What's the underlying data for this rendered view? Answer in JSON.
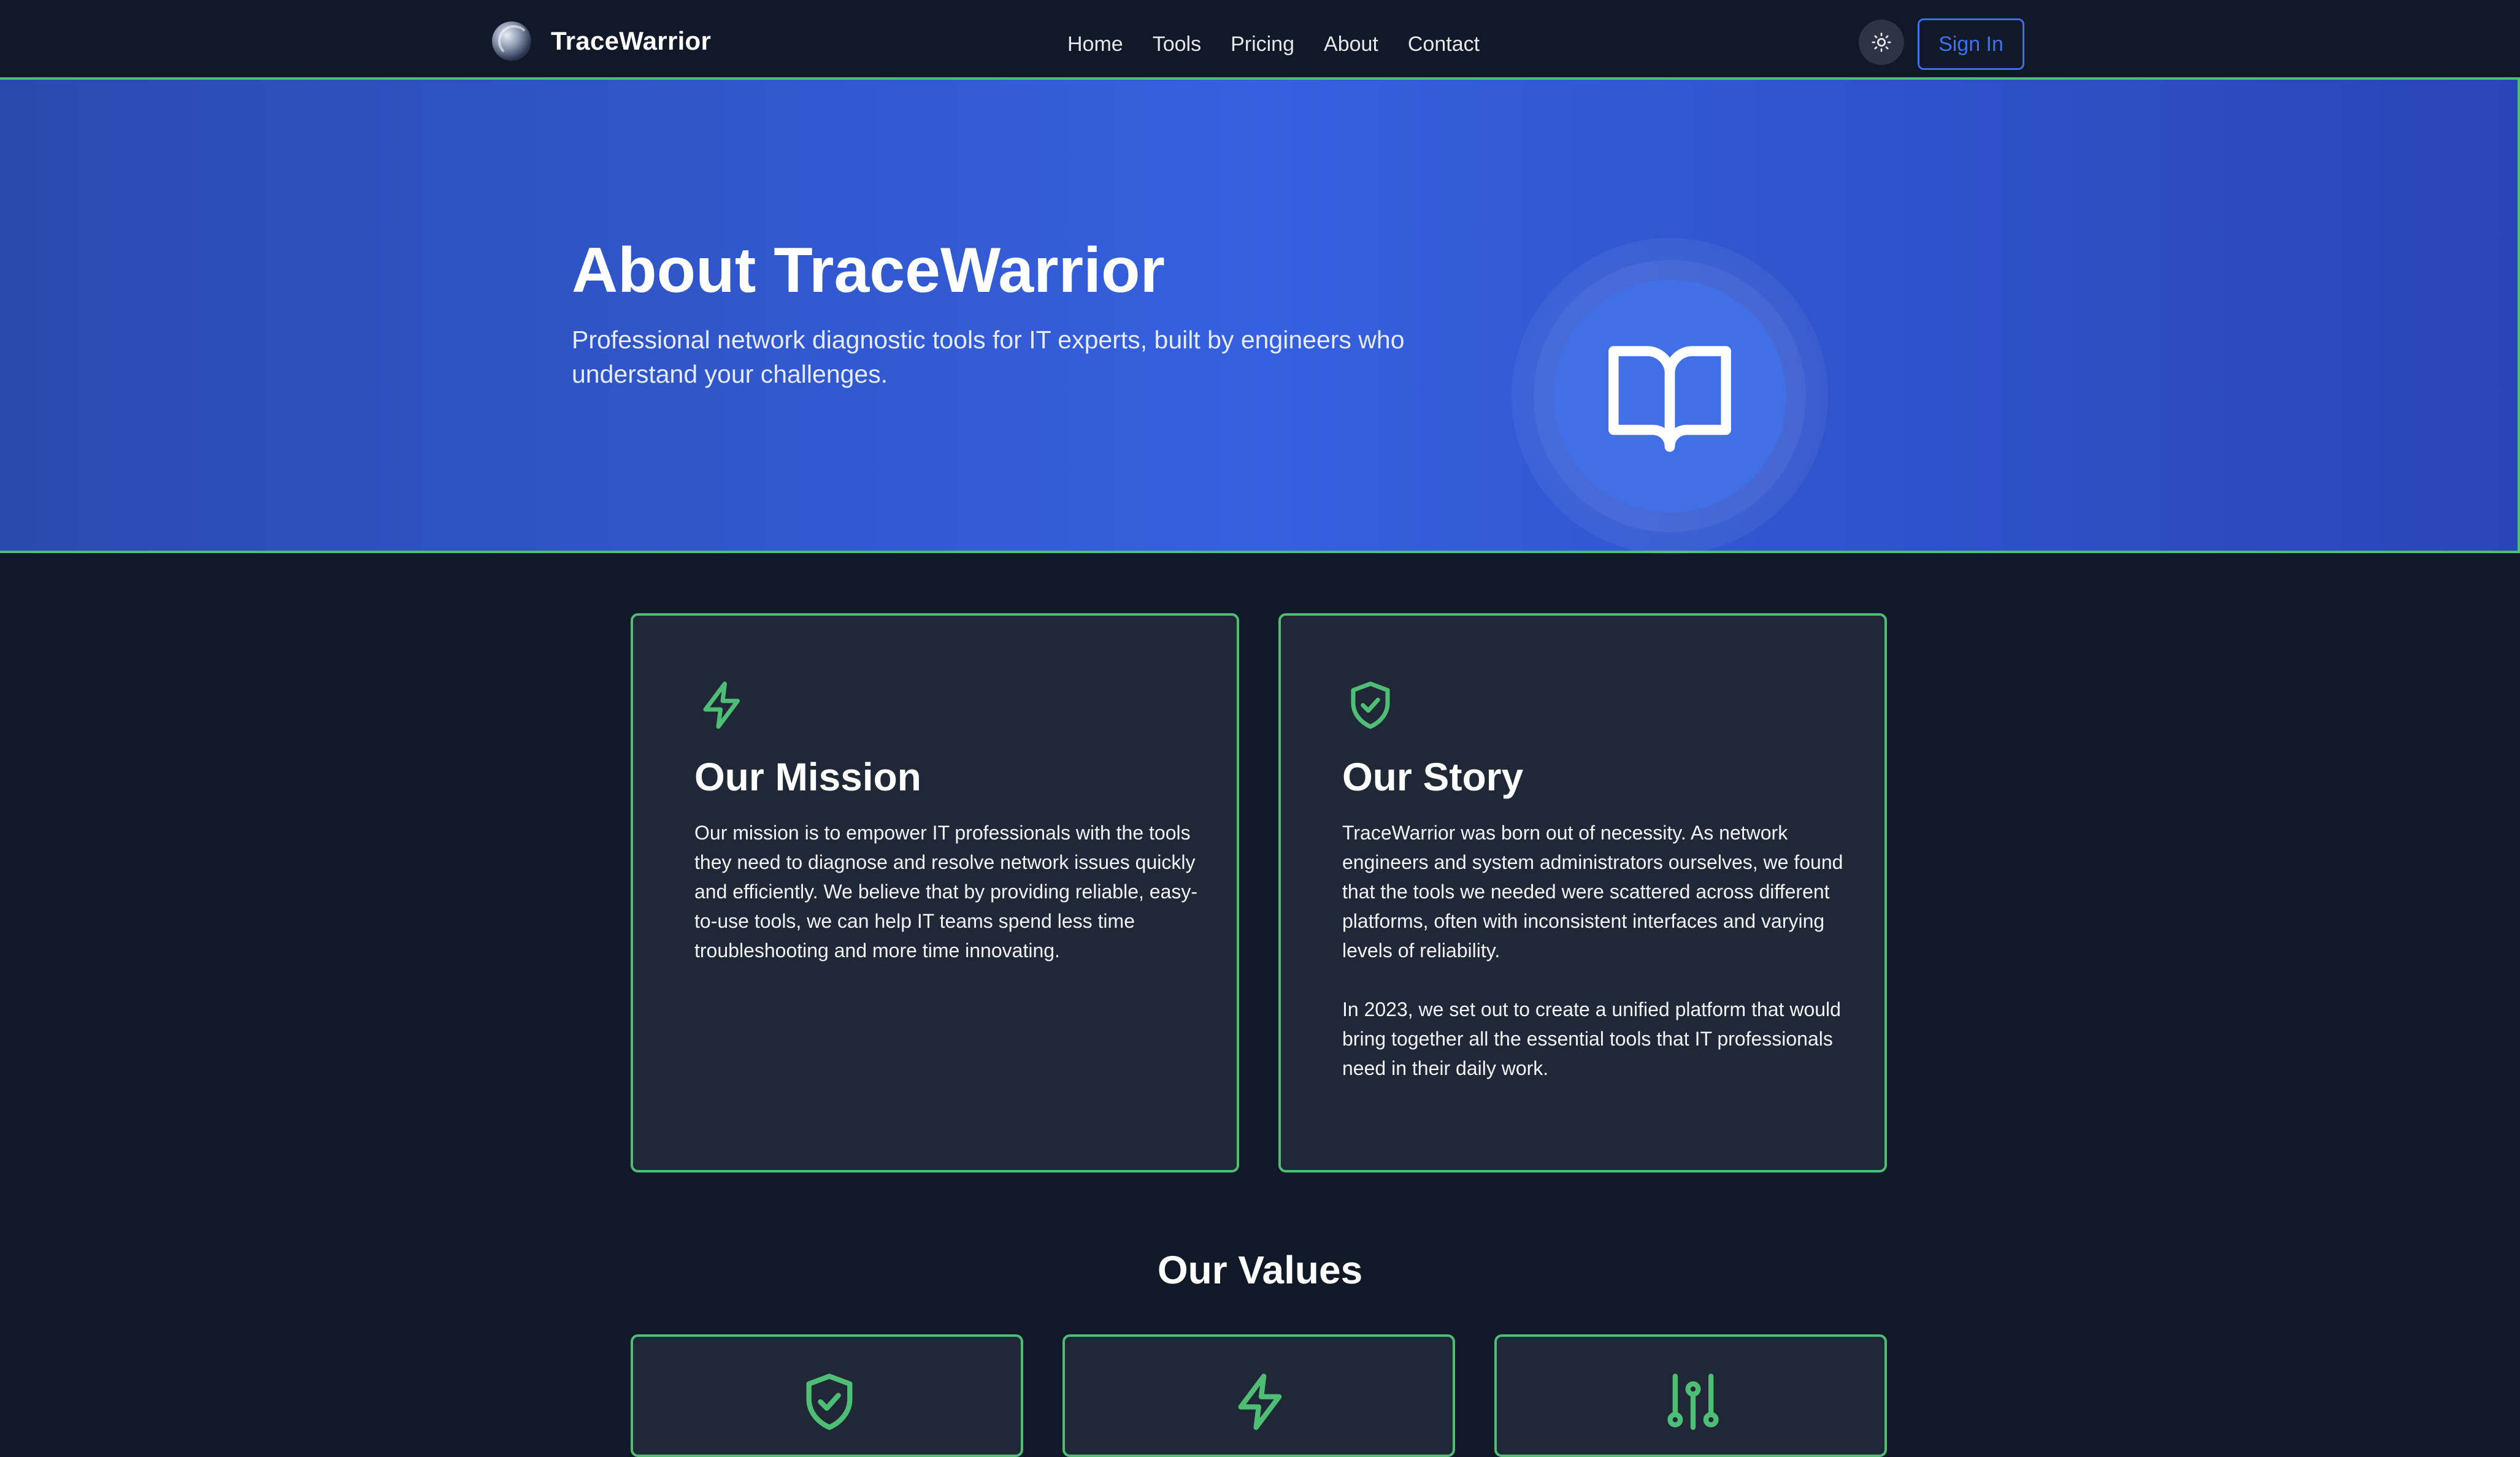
{
  "navbar": {
    "brand_name": "TraceWarrior",
    "links": [
      "Home",
      "Tools",
      "Pricing",
      "About",
      "Contact"
    ],
    "theme_toggle_icon": "sun-icon",
    "signin_label": "Sign In"
  },
  "hero": {
    "title": "About TraceWarrior",
    "subtitle": "Professional network diagnostic tools for IT experts, built by engineers who understand your challenges.",
    "icon": "book-open-icon"
  },
  "mission": {
    "icon": "zap-icon",
    "title": "Our Mission",
    "body": "Our mission is to empower IT professionals with the tools they need to diagnose and resolve network issues quickly and efficiently. We believe that by providing reliable, easy-to-use tools, we can help IT teams spend less time troubleshooting and more time innovating."
  },
  "story": {
    "icon": "shield-check-icon",
    "title": "Our Story",
    "paragraphs": [
      "TraceWarrior was born out of necessity. As network engineers and system administrators ourselves, we found that the tools we needed were scattered across different platforms, often with inconsistent interfaces and varying levels of reliability.",
      "In 2023, we set out to create a unified platform that would bring together all the essential tools that IT professionals need in their daily work."
    ]
  },
  "values": {
    "title": "Our Values",
    "cards": [
      {
        "icon": "shield-check-icon"
      },
      {
        "icon": "zap-icon"
      },
      {
        "icon": "sliders-icon"
      }
    ]
  },
  "colors": {
    "background": "#111828",
    "card": "#202838",
    "accent_green": "#4ebe74",
    "brand_blue": "#3b6ff0",
    "hero_blue": "#3560df"
  }
}
